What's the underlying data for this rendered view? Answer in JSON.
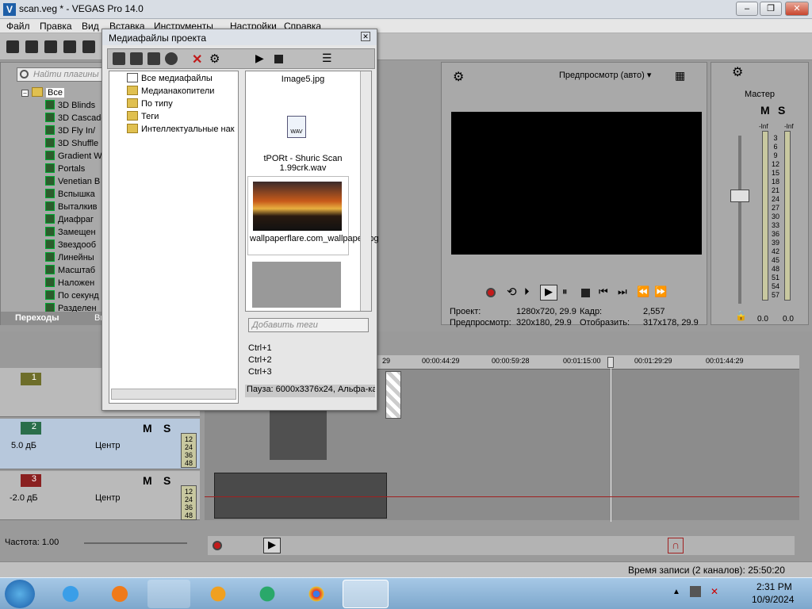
{
  "window": {
    "title": "scan.veg * - VEGAS Pro 14.0"
  },
  "menu": [
    "Файл",
    "Правка",
    "Вид",
    "Вставка",
    "Инструменты",
    "Настройки",
    "Справка"
  ],
  "left_panel": {
    "search_placeholder": "Найти плагины",
    "root": "Все",
    "items": [
      "3D Blinds",
      "3D Cascade",
      "3D Fly In/",
      "3D Shuffle",
      "Gradient W",
      "Portals",
      "Venetian B",
      "Вспышка",
      "Выталкив",
      "Диафраг",
      "Замещен",
      "Звездооб",
      "Линейны",
      "Масштаб",
      "Наложен",
      "По секунд",
      "Разделен"
    ],
    "tabs": [
      "Переходы",
      "Ви"
    ]
  },
  "media_dialog": {
    "title": "Медиафайлы проекта",
    "tree": [
      "Все медиафайлы",
      "Медианакопители",
      "По типу",
      "Теги",
      "Интеллектуальные нак"
    ],
    "files": [
      {
        "name": "Image5.jpg"
      },
      {
        "name": "tPORt - Shuric Scan 1.99crk.wav",
        "badge": "WAV"
      },
      {
        "name": "wallpaperflare.com_wallpaper.jpg"
      }
    ],
    "tag_placeholder": "Добавить теги",
    "shortcuts": [
      "Ctrl+1",
      "Ctrl+2",
      "Ctrl+3"
    ],
    "status": "Пауза: 6000x3376x24, Альфа-ка"
  },
  "preview": {
    "mode": "Предпросмотр (авто)",
    "project_label": "Проект:",
    "project_value": "1280x720, 29.9",
    "preview_label": "Предпросмотр:",
    "preview_value": "320x180, 29.9",
    "frame_label": "Кадр:",
    "frame_value": "2,557",
    "display_label": "Отобразить:",
    "display_value": "317x178, 29.9"
  },
  "master": {
    "label": "Мастер",
    "m": "M",
    "s": "S",
    "scale": [
      "3",
      "6",
      "9",
      "12",
      "15",
      "18",
      "21",
      "24",
      "27",
      "30",
      "33",
      "36",
      "39",
      "42",
      "45",
      "48",
      "51",
      "54",
      "57"
    ],
    "inf": [
      "-Inf",
      "-Inf"
    ],
    "readouts": [
      "0.0",
      "0.0"
    ]
  },
  "timeline": {
    "ticks": [
      "00:00:44:29",
      "00:00:59:28",
      "00:01:15:00",
      "00:01:29:29",
      "00:01:44:29",
      "29"
    ],
    "tracks": [
      {
        "num": "1"
      },
      {
        "num": "2",
        "m": "M",
        "s": "S",
        "vol": "5.0 дБ",
        "pan": "Центр"
      },
      {
        "num": "3",
        "m": "M",
        "s": "S",
        "vol": "-2.0 дБ",
        "pan": "Центр"
      }
    ],
    "meter_nums": [
      "12",
      "24",
      "36",
      "48"
    ],
    "rate_label": "Частота: 1.00",
    "record_time": "Время записи (2 каналов): 25:50:20"
  },
  "tray": {
    "time": "2:31 PM",
    "date": "10/9/2024"
  }
}
